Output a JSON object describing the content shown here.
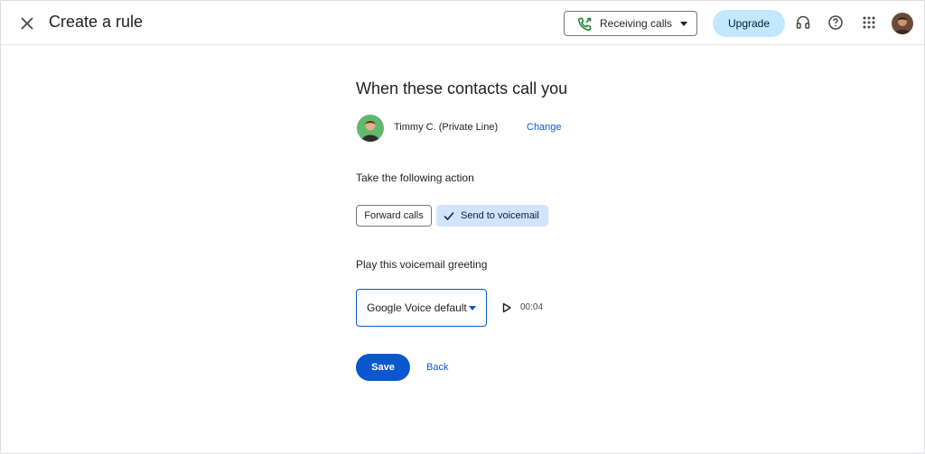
{
  "header": {
    "title": "Create a rule",
    "status_label": "Receiving calls",
    "upgrade_label": "Upgrade",
    "icons": [
      "close-icon",
      "phone-forwarded-icon",
      "chevron-down-icon",
      "headset-icon",
      "help-icon",
      "apps-grid-icon",
      "account-avatar"
    ]
  },
  "main": {
    "section_title": "When these contacts call you",
    "contact": {
      "name": "Timmy C. (Private Line)",
      "change_label": "Change"
    },
    "action_heading": "Take the following action",
    "actions": [
      {
        "label": "Forward calls",
        "selected": false
      },
      {
        "label": "Send to voicemail",
        "selected": true
      }
    ],
    "greeting_heading": "Play this voicemail greeting",
    "greeting_value": "Google Voice default",
    "greeting_duration": "00:04",
    "save_label": "Save",
    "back_label": "Back"
  },
  "colors": {
    "primary": "#0b57d0",
    "upgrade_bg": "#c2e7ff",
    "selected_chip_bg": "#d3e3fd",
    "status_green": "#188038"
  }
}
